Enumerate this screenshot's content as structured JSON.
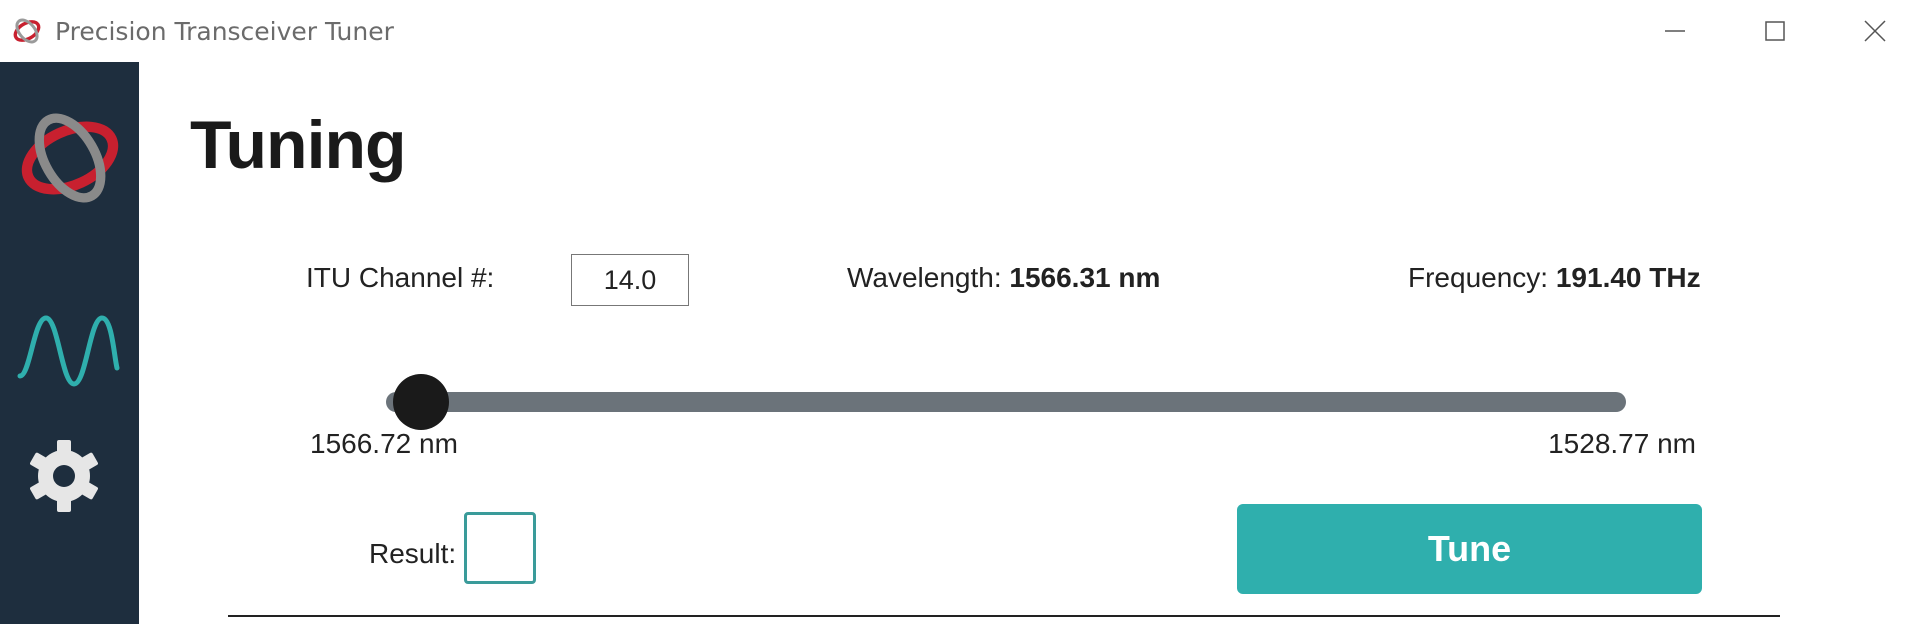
{
  "window": {
    "title": "Precision Transceiver Tuner",
    "minimize_icon": "minimize-icon",
    "maximize_icon": "maximize-icon",
    "close_icon": "close-icon"
  },
  "sidebar": {
    "items": [
      {
        "icon": "logo-icon"
      },
      {
        "icon": "waveform-icon"
      },
      {
        "icon": "gear-icon"
      }
    ]
  },
  "page": {
    "title": "Tuning"
  },
  "tuning": {
    "channel_label": "ITU Channel #:",
    "channel_value": "14.0",
    "wavelength_label": "Wavelength:",
    "wavelength_value": "1566.31 nm",
    "frequency_label": "Frequency:",
    "frequency_value": "191.40 THz",
    "slider_min_label": "1566.72 nm",
    "slider_max_label": "1528.77 nm",
    "slider_position_fraction": 0.02,
    "result_label": "Result:",
    "tune_label": "Tune"
  },
  "colors": {
    "sidebar_bg": "#1e2e3e",
    "accent_teal": "#2fafad",
    "logo_red": "#c8202f",
    "logo_gray": "#8a8a8a",
    "slider_track": "#6b737a"
  }
}
